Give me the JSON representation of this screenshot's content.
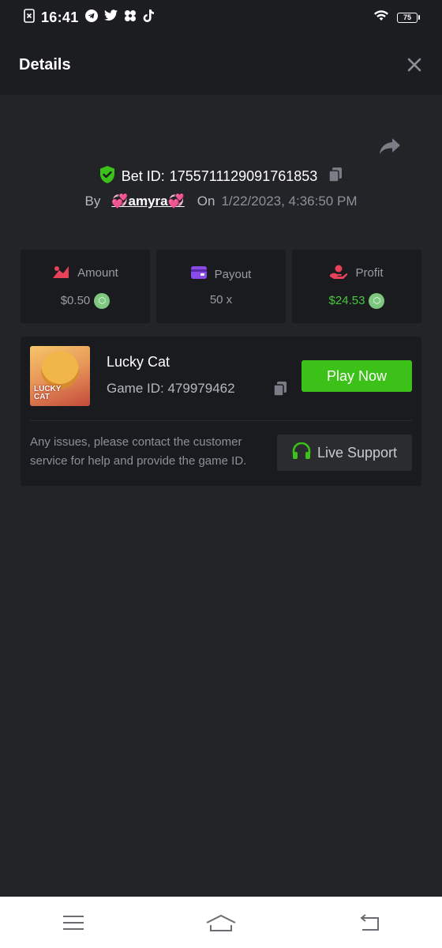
{
  "status_bar": {
    "time": "16:41",
    "battery": "75",
    "icons": [
      "sim-error-icon",
      "telegram-icon",
      "twitter-icon",
      "app-icon",
      "tiktok-icon"
    ]
  },
  "header": {
    "title": "Details"
  },
  "bet": {
    "label": "Bet ID:",
    "id": "1755711129091761853",
    "by_label": "By",
    "username": "💞amyra💞",
    "on_label": "On",
    "date": "1/22/2023, 4:36:50 PM"
  },
  "stats": {
    "amount_label": "Amount",
    "amount_value": "$0.50",
    "payout_label": "Payout",
    "payout_value": "50 x",
    "profit_label": "Profit",
    "profit_value": "$24.53"
  },
  "game": {
    "name": "Lucky Cat",
    "id_text": "Game ID: 479979462",
    "thumb_line1": "LUCKY",
    "thumb_line2": "CAT",
    "play_label": "Play Now",
    "help_text": "Any issues, please contact the customer service for help and provide the game ID.",
    "support_label": "Live Support"
  },
  "colors": {
    "background": "#232428",
    "panel": "#1a1b1e",
    "play_button": "#3bc117",
    "profit": "#47c83e",
    "shield": "#3bc117"
  }
}
